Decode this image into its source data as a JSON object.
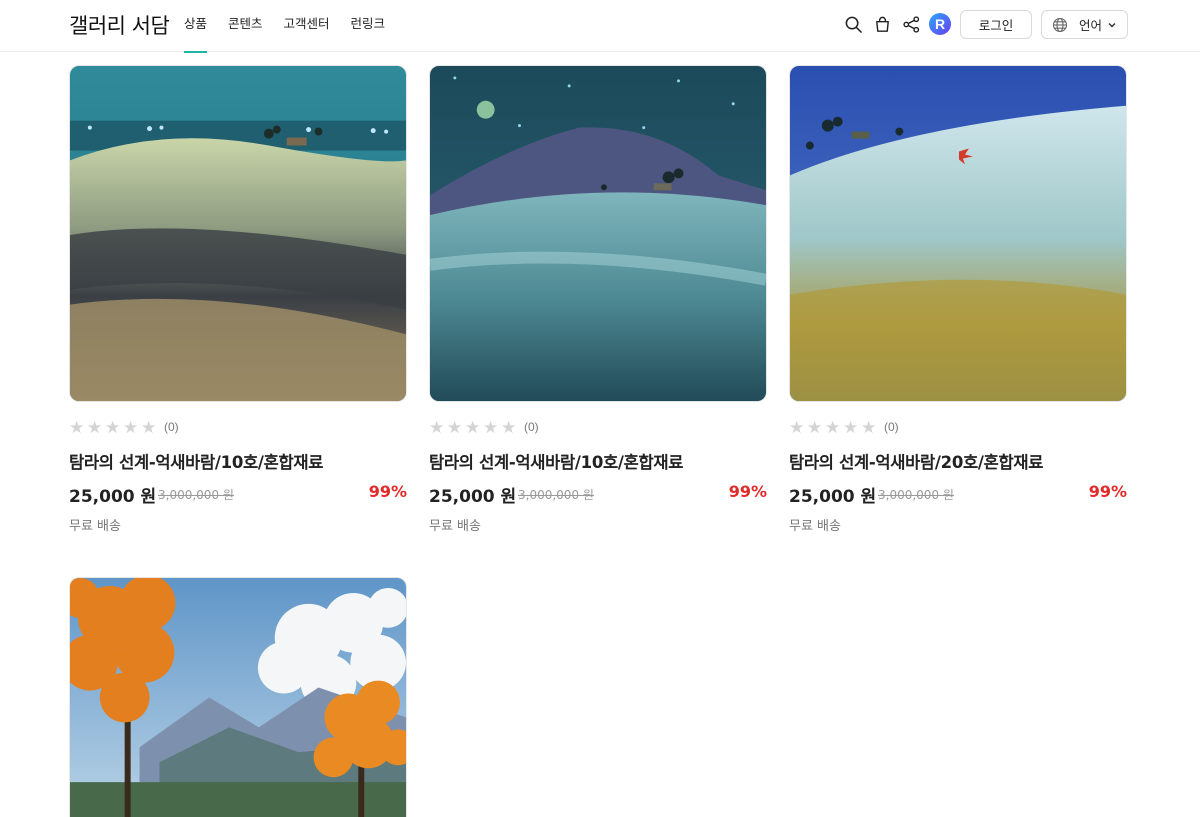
{
  "header": {
    "logo": "갤러리 서담",
    "nav": [
      {
        "label": "상품",
        "active": true
      },
      {
        "label": "콘텐츠",
        "active": false
      },
      {
        "label": "고객센터",
        "active": false
      },
      {
        "label": "런링크",
        "active": false
      }
    ],
    "icons": [
      "search-icon",
      "cart-icon",
      "share-icon",
      "brand-r-icon"
    ],
    "badge_letter": "R",
    "login_label": "로그인",
    "language_label": "언어",
    "accent_color": "#1fb6a6"
  },
  "products": [
    {
      "name": "탐라의 선계-억새바람/10호/혼합재료",
      "rating_count": "(0)",
      "price": "25,000 원",
      "original_price": "3,000,000 원",
      "discount": "99%",
      "shipping": "무료 배송",
      "stars": 0
    },
    {
      "name": "탐라의 선계-억새바람/10호/혼합재료",
      "rating_count": "(0)",
      "price": "25,000 원",
      "original_price": "3,000,000 원",
      "discount": "99%",
      "shipping": "무료 배송",
      "stars": 0
    },
    {
      "name": "탐라의 선계-억새바람/20호/혼합재료",
      "rating_count": "(0)",
      "price": "25,000 원",
      "original_price": "3,000,000 원",
      "discount": "99%",
      "shipping": "무료 배송",
      "stars": 0
    },
    {
      "name": "",
      "rating_count": "",
      "price": "",
      "original_price": "",
      "discount": "",
      "shipping": "",
      "stars": 0
    }
  ],
  "colors": {
    "discount": "#e02b2b",
    "star_empty": "#d4d4d4"
  }
}
